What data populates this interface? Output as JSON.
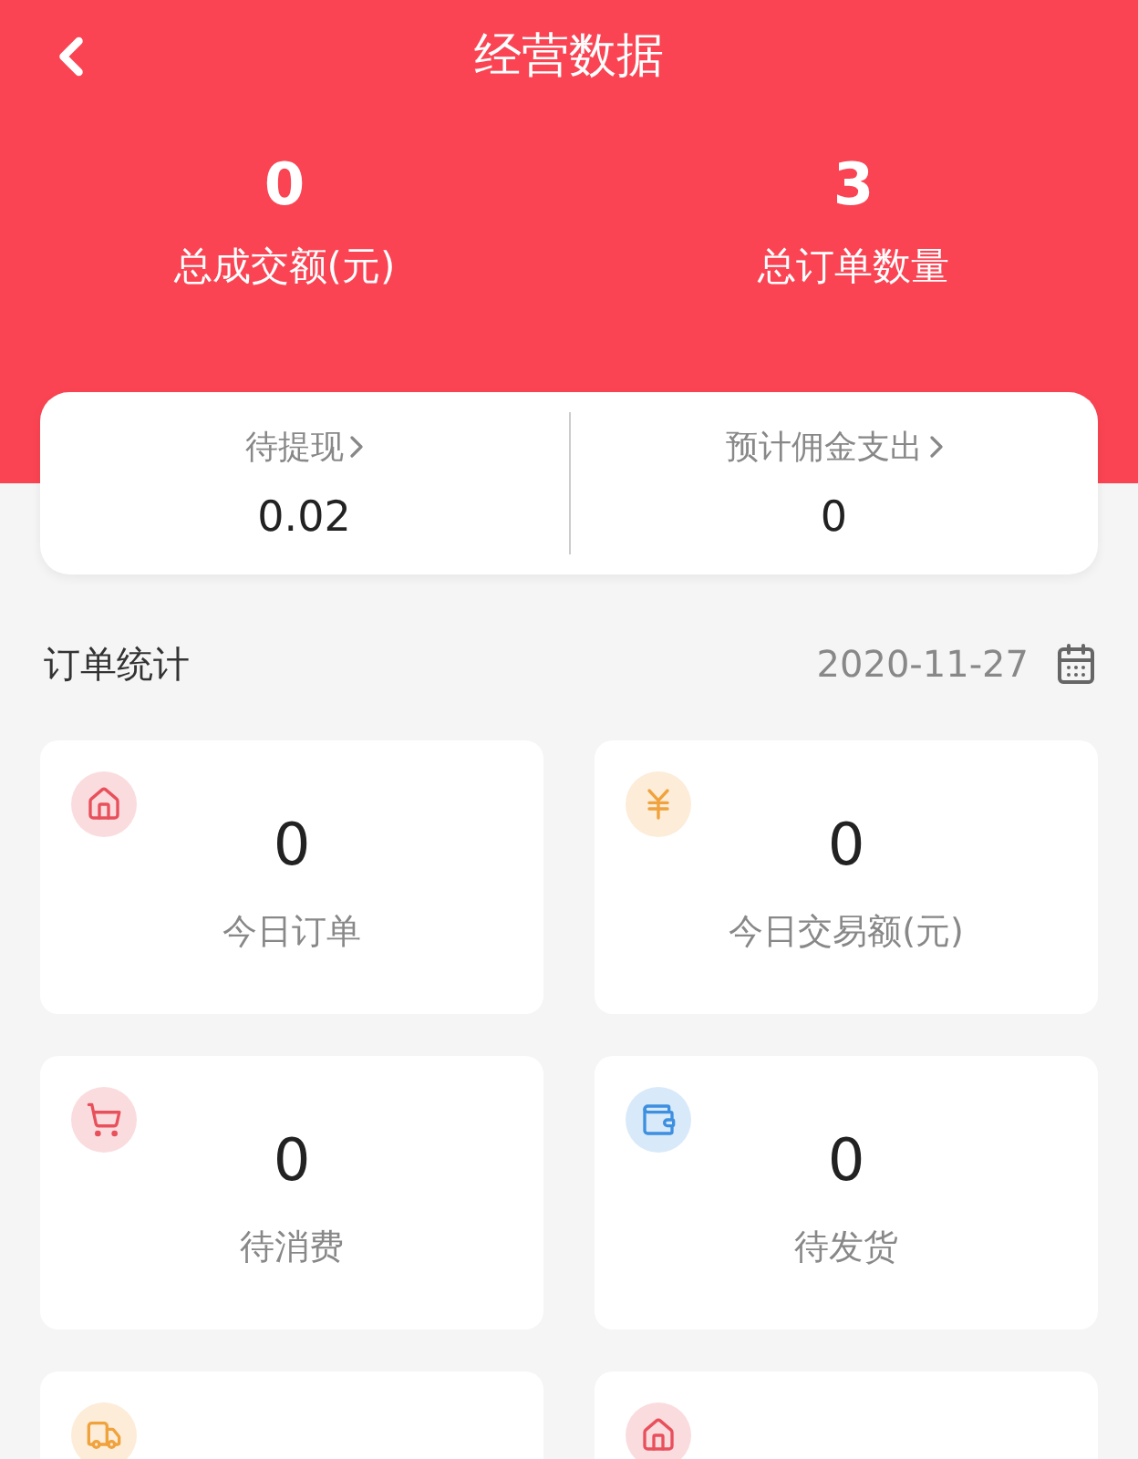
{
  "header": {
    "title": "经营数据"
  },
  "totals": [
    {
      "value": "0",
      "label": "总成交额(元)"
    },
    {
      "value": "3",
      "label": "总订单数量"
    }
  ],
  "summary": [
    {
      "label": "待提现",
      "value": "0.02"
    },
    {
      "label": "预计佣金支出",
      "value": "0"
    }
  ],
  "order_stats": {
    "title": "订单统计",
    "date": "2020-11-27"
  },
  "cards": [
    {
      "kind": "store",
      "color": "#e8505b",
      "value": "0",
      "label": "今日订单"
    },
    {
      "kind": "yen",
      "color": "#f0a23c",
      "value": "0",
      "label": "今日交易额(元)"
    },
    {
      "kind": "cart",
      "color": "#e8505b",
      "value": "0",
      "label": "待消费"
    },
    {
      "kind": "wallet",
      "color": "#3d8fe0",
      "value": "0",
      "label": "待发货"
    },
    {
      "kind": "truck",
      "color": "#f0a23c"
    },
    {
      "kind": "store",
      "color": "#e8505b"
    }
  ]
}
